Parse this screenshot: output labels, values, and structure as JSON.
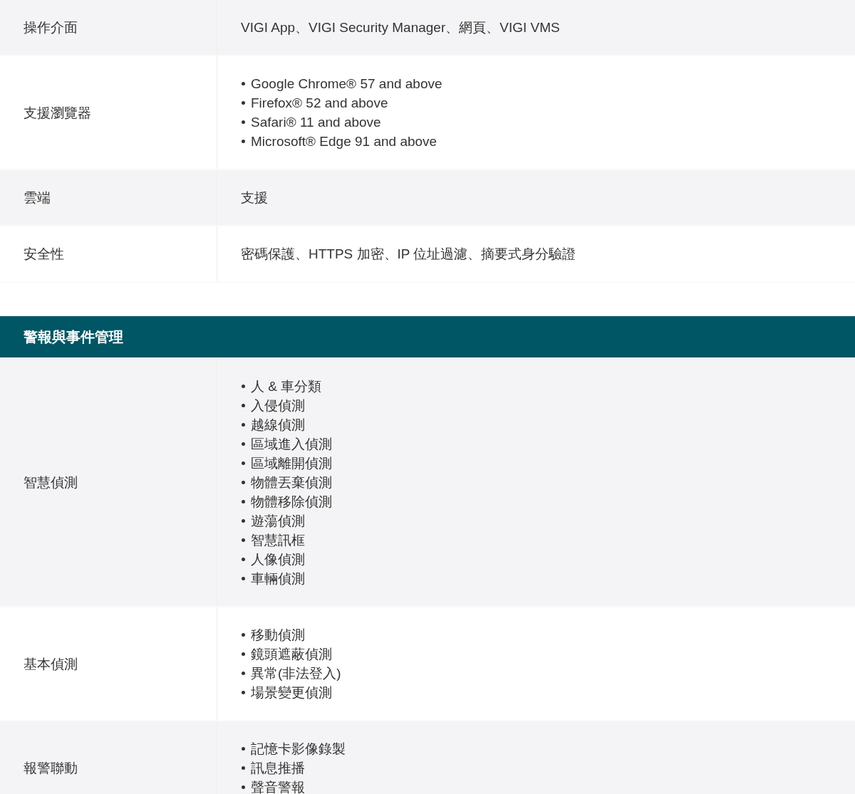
{
  "sections": [
    {
      "rows": [
        {
          "label": "操作介面",
          "kind": "text",
          "value": "VIGI App、VIGI Security Manager、網頁、VIGI VMS"
        },
        {
          "label": "支援瀏覽器",
          "kind": "list",
          "items": [
            "Google Chrome® 57 and above",
            "Firefox® 52 and above",
            "Safari® 11 and above",
            "Microsoft® Edge 91 and above"
          ]
        },
        {
          "label": "雲端",
          "kind": "text",
          "value": "支援"
        },
        {
          "label": "安全性",
          "kind": "text",
          "value": "密碼保護、HTTPS 加密、IP 位址過濾、摘要式身分驗證"
        }
      ]
    },
    {
      "heading": "警報與事件管理",
      "rows": [
        {
          "label": "智慧偵測",
          "kind": "list",
          "items": [
            "人 & 車分類",
            "入侵偵測",
            "越線偵測",
            "區域進入偵測",
            "區域離開偵測",
            "物體丟棄偵測",
            "物體移除偵測",
            "遊蕩偵測",
            "智慧訊框",
            "人像偵測",
            "車輛偵測"
          ]
        },
        {
          "label": "基本偵測",
          "kind": "list",
          "items": [
            "移動偵測",
            "鏡頭遮蔽偵測",
            "異常(非法登入)",
            "場景變更偵測"
          ]
        },
        {
          "label": "報警聯動",
          "kind": "list",
          "items": [
            "記憶卡影像錄製",
            "訊息推播",
            "聲音警報"
          ]
        }
      ]
    }
  ]
}
